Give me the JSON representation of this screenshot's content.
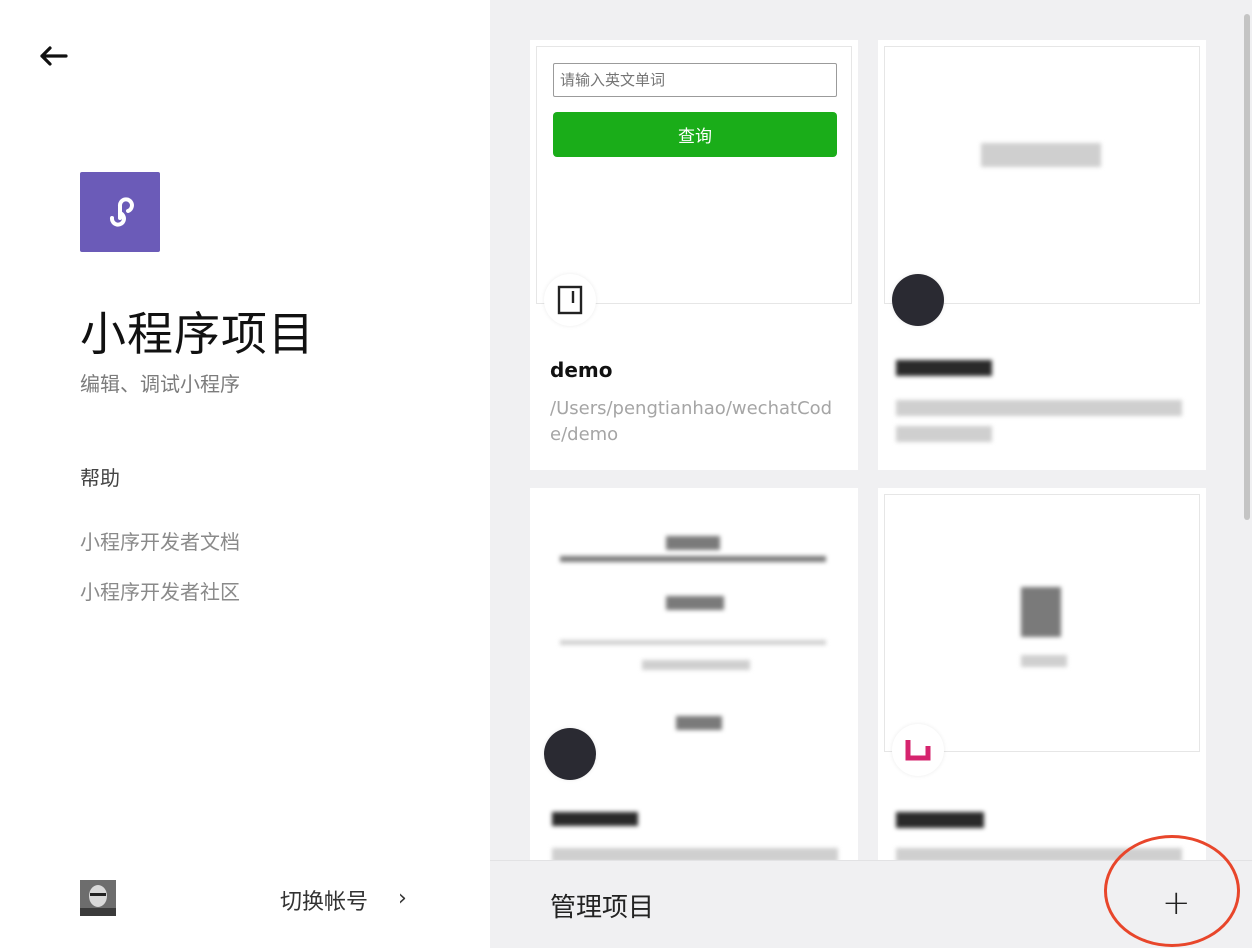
{
  "sidebar": {
    "back_icon": "arrow-left-icon",
    "logo_icon": "miniprogram-link-icon",
    "title": "小程序项目",
    "subtitle": "编辑、调试小程序",
    "help_heading": "帮助",
    "help_links": [
      "小程序开发者文档",
      "小程序开发者社区"
    ],
    "switch_account": "切换帐号",
    "switch_chevron": "›",
    "accent_color": "#6b5bb8"
  },
  "projects": {
    "card1": {
      "search_placeholder": "请输入英文单词",
      "query_button": "查询",
      "name": "demo",
      "path": "/Users/pengtianhao/wechatCode/demo"
    }
  },
  "bottom": {
    "manage_label": "管理项目",
    "add_label": "+",
    "add_highlight_color": "#e8462b"
  }
}
